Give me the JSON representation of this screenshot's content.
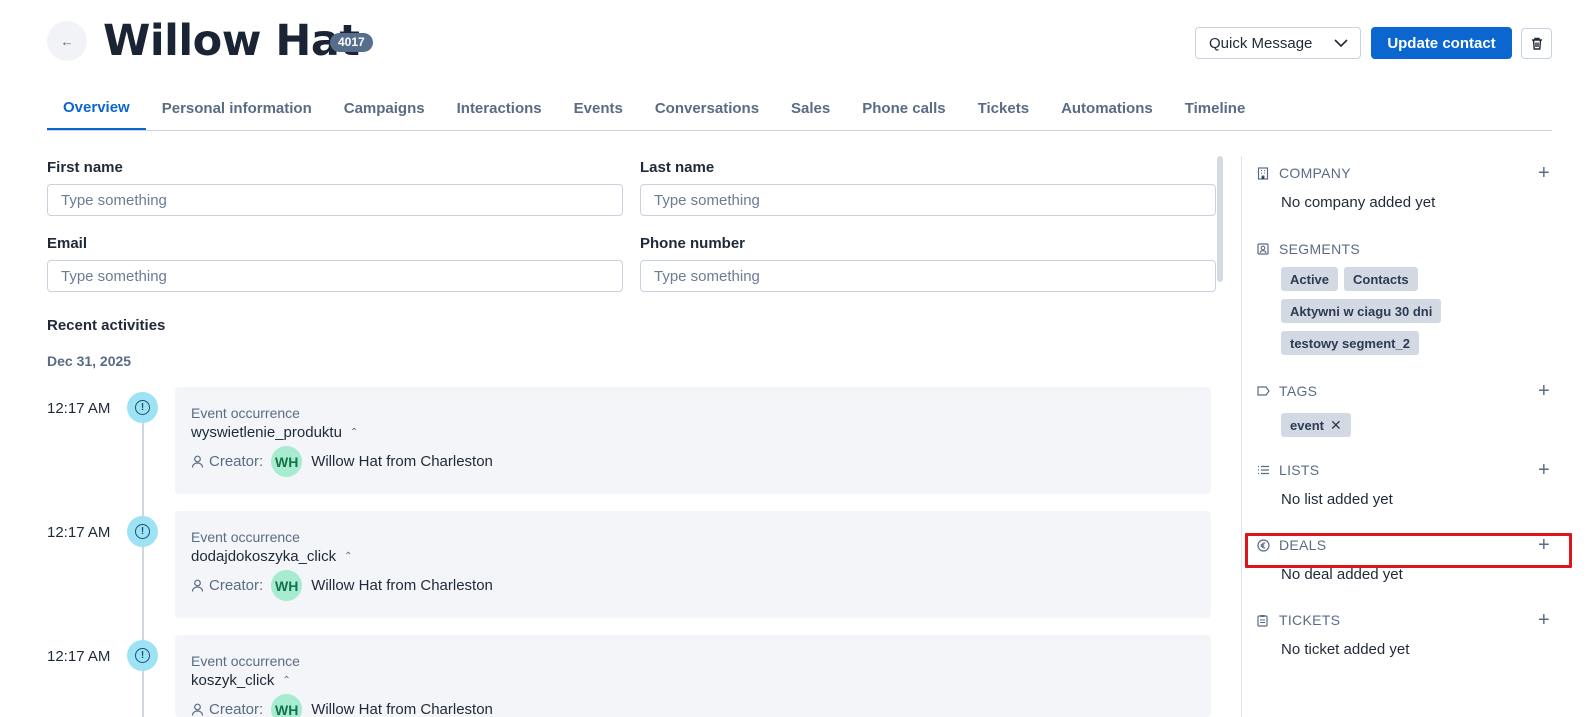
{
  "header": {
    "back_icon": "arrow-left-icon",
    "title": "Willow Hat",
    "badge": "4017",
    "quick_message": "Quick Message",
    "update_button": "Update contact",
    "trash_icon": "trash-icon"
  },
  "tabs": [
    {
      "label": "Overview",
      "active": true
    },
    {
      "label": "Personal information",
      "active": false
    },
    {
      "label": "Campaigns",
      "active": false
    },
    {
      "label": "Interactions",
      "active": false
    },
    {
      "label": "Events",
      "active": false
    },
    {
      "label": "Conversations",
      "active": false
    },
    {
      "label": "Sales",
      "active": false
    },
    {
      "label": "Phone calls",
      "active": false
    },
    {
      "label": "Tickets",
      "active": false
    },
    {
      "label": "Automations",
      "active": false
    },
    {
      "label": "Timeline",
      "active": false
    }
  ],
  "form": {
    "first_name": {
      "label": "First name",
      "placeholder": "Type something",
      "value": ""
    },
    "last_name": {
      "label": "Last name",
      "placeholder": "Type something",
      "value": ""
    },
    "email": {
      "label": "Email",
      "placeholder": "Type something",
      "value": ""
    },
    "phone": {
      "label": "Phone number",
      "placeholder": "Type something",
      "value": ""
    }
  },
  "activities": {
    "title": "Recent activities",
    "date": "Dec 31, 2025",
    "creator_label": "Creator:",
    "items": [
      {
        "time": "12:17 AM",
        "type": "Event occurrence",
        "name": "wyswietlenie_produktu",
        "avatar": "WH",
        "creator": "Willow Hat from Charleston"
      },
      {
        "time": "12:17 AM",
        "type": "Event occurrence",
        "name": "dodajdokoszyka_click",
        "avatar": "WH",
        "creator": "Willow Hat from Charleston"
      },
      {
        "time": "12:17 AM",
        "type": "Event occurrence",
        "name": "koszyk_click",
        "avatar": "WH",
        "creator": "Willow Hat from Charleston"
      }
    ]
  },
  "sidebar": {
    "company": {
      "title": "COMPANY",
      "icon": "building-icon",
      "empty": "No company added yet"
    },
    "segments": {
      "title": "SEGMENTS",
      "icon": "segment-icon",
      "chips": [
        "Active",
        "Contacts",
        "Aktywni w ciagu 30 dni",
        "testowy segment_2"
      ]
    },
    "tags": {
      "title": "TAGS",
      "icon": "tag-icon",
      "chips": [
        "event"
      ]
    },
    "lists": {
      "title": "LISTS",
      "icon": "list-icon",
      "empty": "No list added yet"
    },
    "deals": {
      "title": "DEALS",
      "icon": "euro-icon",
      "empty": "No deal added yet"
    },
    "tickets": {
      "title": "TICKETS",
      "icon": "clipboard-icon",
      "empty": "No ticket added yet"
    }
  },
  "colors": {
    "accent": "#0b66d0",
    "highlight": "#e0151b",
    "avatar_bg": "#a7ecd0",
    "event_dot": "#9ee3f5"
  }
}
